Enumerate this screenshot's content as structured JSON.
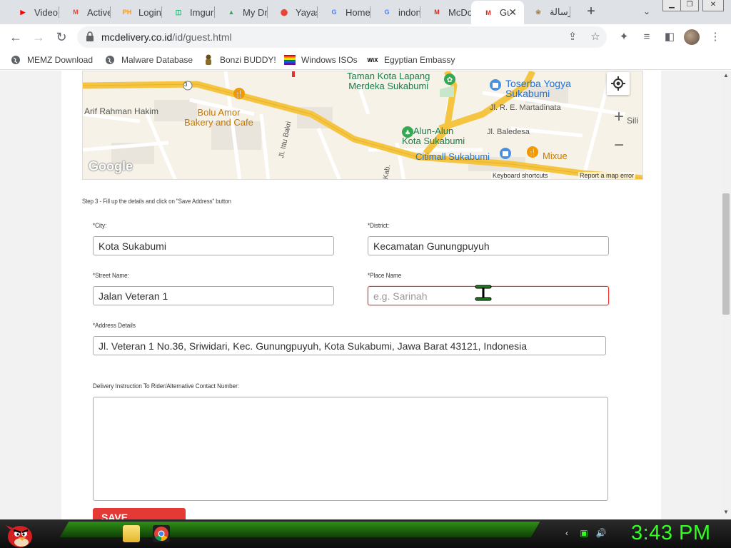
{
  "tabs": [
    {
      "label": "Video",
      "favicon": "youtube-icon",
      "color": "#ff0000",
      "glyph": "▶"
    },
    {
      "label": "Active",
      "favicon": "gmail-icon",
      "color": "#ea4335",
      "glyph": "M"
    },
    {
      "label": "Login",
      "favicon": "ph-icon",
      "color": "#f7971d",
      "glyph": "PH"
    },
    {
      "label": "Imgur",
      "favicon": "imgur-icon",
      "color": "#1bb76e",
      "glyph": "◫"
    },
    {
      "label": "My Drive",
      "favicon": "drive-icon",
      "color": "#34a853",
      "glyph": "▲"
    },
    {
      "label": "Yayasan",
      "favicon": "maps-icon",
      "color": "#ea4335",
      "glyph": "⬤"
    },
    {
      "label": "Home",
      "favicon": "google-icon",
      "color": "#4285f4",
      "glyph": "G"
    },
    {
      "label": "indonesia",
      "favicon": "google-icon",
      "color": "#4285f4",
      "glyph": "G"
    },
    {
      "label": "McDonald's",
      "favicon": "mcdonalds-icon",
      "color": "#da291c",
      "glyph": "M"
    },
    {
      "label": "Guest",
      "favicon": "mcdonalds-icon",
      "color": "#da291c",
      "glyph": "M",
      "active": true
    },
    {
      "label": "رسالة",
      "favicon": "arabic-site-icon",
      "color": "#b08850",
      "glyph": "❀"
    }
  ],
  "browser": {
    "url_host": "mcdelivery.co.id",
    "url_path": "/id/guest.html"
  },
  "bookmarks": [
    {
      "label": "MEMZ Download",
      "icon": "globe-icon"
    },
    {
      "label": "Malware Database",
      "icon": "globe-icon"
    },
    {
      "label": "Bonzi BUDDY!",
      "icon": "bonzi-icon"
    },
    {
      "label": "Windows ISOs",
      "icon": "rainbow-flag-icon"
    },
    {
      "label": "Egyptian Embassy",
      "icon": "wix-icon"
    }
  ],
  "map": {
    "labels": {
      "taman": "Taman Kota Lapang\nMerdeka Sukabumi",
      "toserba": "Toserba Yogya\nSukabumi",
      "bolu": "Bolu Amor\nBakery and Cafe",
      "alun": "Alun-Alun\nKota Sukabumi",
      "citimall": "Citimall Sukabumi",
      "mixue": "Mixue",
      "arif": "Arif Rahman Hakim",
      "martadinata": "Jl. R. E. Martadinata",
      "baledesa": "Jl. Baledesa",
      "bakri": "Jl. Ittu Bakri",
      "kab": "Kab.",
      "sili": "Sili",
      "route": "3"
    },
    "google": "Google",
    "shortcuts": "Keyboard shortcuts",
    "report": "Report a map error"
  },
  "form": {
    "step": "Step 3 - Fill up the details and click on \"Save Address\" button",
    "city_label": "*City:",
    "city_value": "Kota Sukabumi",
    "district_label": "*District:",
    "district_value": "Kecamatan Gunungpuyuh",
    "street_label": "*Street Name:",
    "street_value": "Jalan Veteran 1",
    "place_label": "*Place Name",
    "place_placeholder": "e.g. Sarinah",
    "address_label": "*Address Details",
    "address_value": "Jl. Veteran 1 No.36, Sriwidari, Kec. Gunungpuyuh, Kota Sukabumi, Jawa Barat 43121, Indonesia",
    "instruction_label": "Delivery Instruction To Rider/Alternative Contact Number:",
    "save_label": "SAVE ADDRESS"
  },
  "taskbar": {
    "clock": "3:43 PM"
  }
}
